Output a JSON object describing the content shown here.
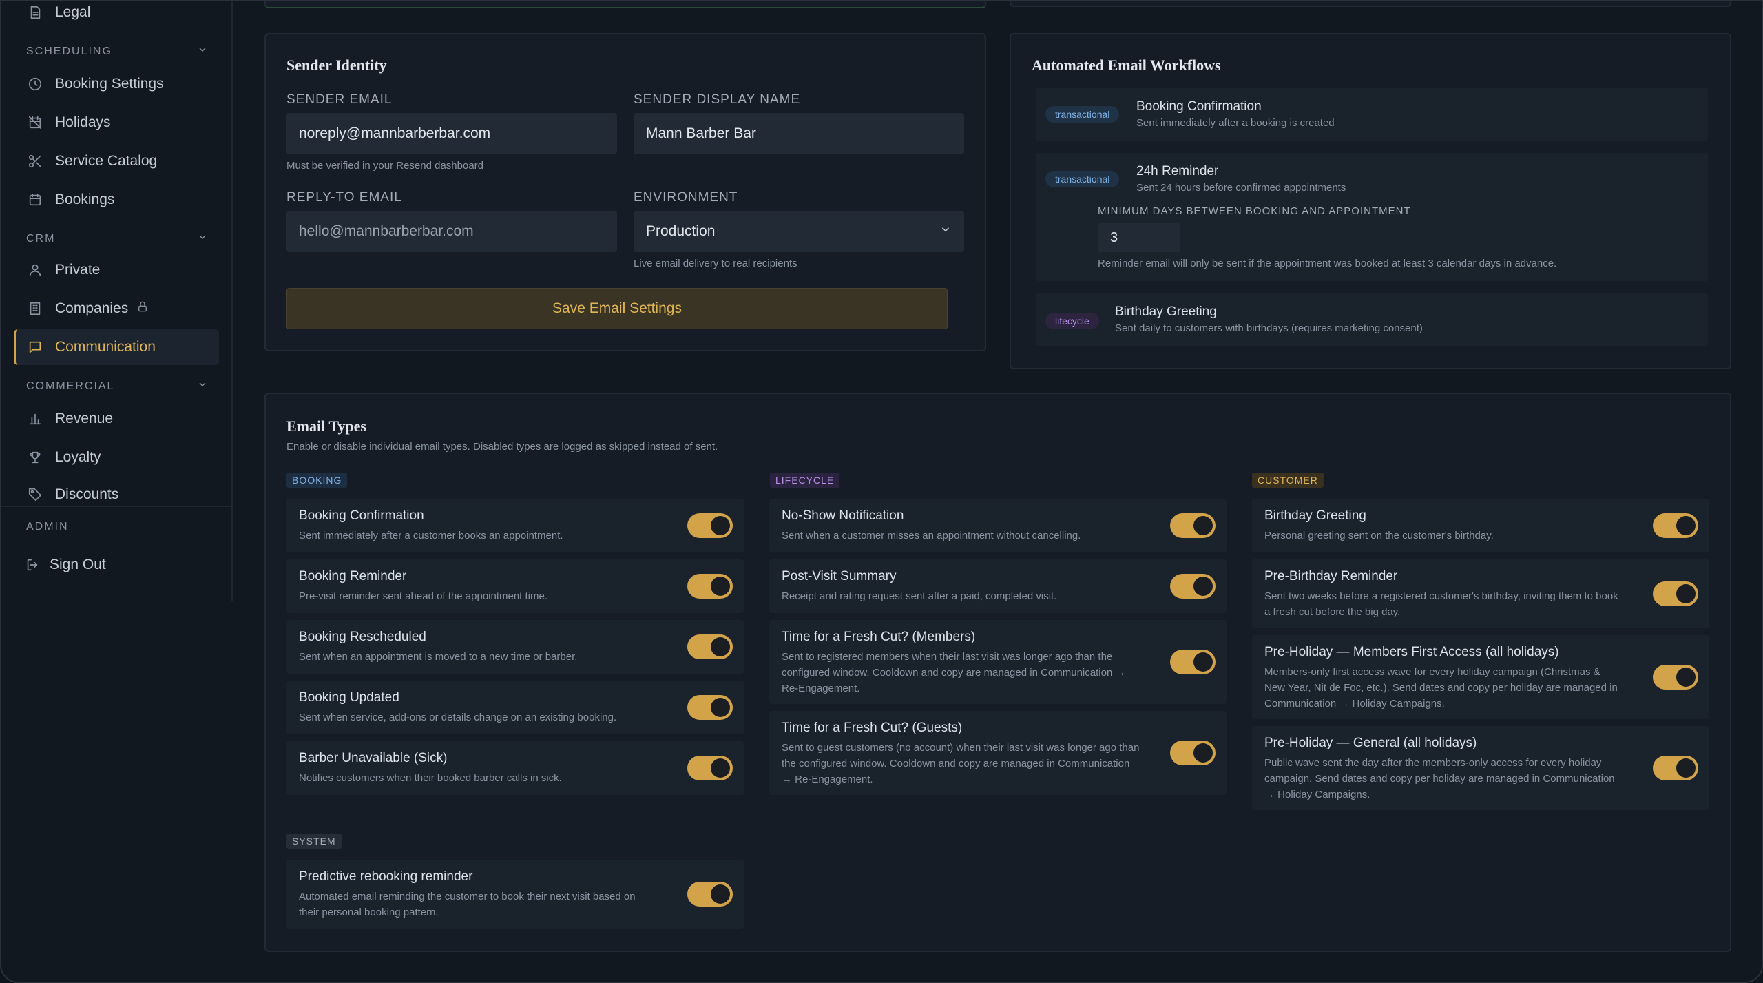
{
  "sidebar": {
    "legal": "Legal",
    "sections": {
      "scheduling": "SCHEDULING",
      "crm": "CRM",
      "commercial": "COMMERCIAL",
      "admin": "ADMIN"
    },
    "items": {
      "booking_settings": "Booking Settings",
      "holidays": "Holidays",
      "service_catalog": "Service Catalog",
      "bookings": "Bookings",
      "private": "Private",
      "companies": "Companies",
      "communication": "Communication",
      "revenue": "Revenue",
      "loyalty": "Loyalty",
      "discounts": "Discounts",
      "sign_out": "Sign Out"
    },
    "accent_color": "#e0b553"
  },
  "sender": {
    "title": "Sender Identity",
    "email_label": "SENDER EMAIL",
    "email_value": "noreply@mannbarberbar.com",
    "email_hint": "Must be verified in your Resend dashboard",
    "display_label": "SENDER DISPLAY NAME",
    "display_value": "Mann Barber Bar",
    "reply_label": "REPLY-TO EMAIL",
    "reply_placeholder": "hello@mannbarberbar.com",
    "env_label": "ENVIRONMENT",
    "env_value": "Production",
    "env_hint": "Live email delivery to real recipients",
    "save_label": "Save Email Settings"
  },
  "workflows": {
    "title": "Automated Email Workflows",
    "items": [
      {
        "badge": "transactional",
        "title": "Booking Confirmation",
        "sub": "Sent immediately after a booking is created"
      },
      {
        "badge": "transactional",
        "title": "24h Reminder",
        "sub": "Sent 24 hours before confirmed appointments",
        "min_label": "MINIMUM DAYS BETWEEN BOOKING AND APPOINTMENT",
        "min_value": "3",
        "min_hint": "Reminder email will only be sent if the appointment was booked at least 3 calendar days in advance."
      },
      {
        "badge": "lifecycle",
        "title": "Birthday Greeting",
        "sub": "Sent daily to customers with birthdays (requires marketing consent)"
      }
    ]
  },
  "email_types": {
    "title": "Email Types",
    "subtitle": "Enable or disable individual email types. Disabled types are logged as skipped instead of sent.",
    "categories": {
      "booking": "BOOKING",
      "lifecycle": "LIFECYCLE",
      "customer": "CUSTOMER",
      "system": "SYSTEM"
    },
    "booking": [
      {
        "title": "Booking Confirmation",
        "desc": "Sent immediately after a customer books an appointment.",
        "enabled": true
      },
      {
        "title": "Booking Reminder",
        "desc": "Pre-visit reminder sent ahead of the appointment time.",
        "enabled": true
      },
      {
        "title": "Booking Rescheduled",
        "desc": "Sent when an appointment is moved to a new time or barber.",
        "enabled": true
      },
      {
        "title": "Booking Updated",
        "desc": "Sent when service, add-ons or details change on an existing booking.",
        "enabled": true
      },
      {
        "title": "Barber Unavailable (Sick)",
        "desc": "Notifies customers when their booked barber calls in sick.",
        "enabled": true
      }
    ],
    "lifecycle": [
      {
        "title": "No-Show Notification",
        "desc": "Sent when a customer misses an appointment without cancelling.",
        "enabled": true
      },
      {
        "title": "Post-Visit Summary",
        "desc": "Receipt and rating request sent after a paid, completed visit.",
        "enabled": true
      },
      {
        "title": "Time for a Fresh Cut? (Members)",
        "desc": "Sent to registered members when their last visit was longer ago than the configured window. Cooldown and copy are managed in Communication → Re-Engagement.",
        "enabled": true
      },
      {
        "title": "Time for a Fresh Cut? (Guests)",
        "desc": "Sent to guest customers (no account) when their last visit was longer ago than the configured window. Cooldown and copy are managed in Communication → Re-Engagement.",
        "enabled": true
      }
    ],
    "customer": [
      {
        "title": "Birthday Greeting",
        "desc": "Personal greeting sent on the customer's birthday.",
        "enabled": true
      },
      {
        "title": "Pre-Birthday Reminder",
        "desc": "Sent two weeks before a registered customer's birthday, inviting them to book a fresh cut before the big day.",
        "enabled": true
      },
      {
        "title": "Pre-Holiday — Members First Access (all holidays)",
        "desc": "Members-only first access wave for every holiday campaign (Christmas & New Year, Nit de Foc, etc.). Send dates and copy per holiday are managed in Communication → Holiday Campaigns.",
        "enabled": true
      },
      {
        "title": "Pre-Holiday — General (all holidays)",
        "desc": "Public wave sent the day after the members-only access for every holiday campaign. Send dates and copy per holiday are managed in Communication → Holiday Campaigns.",
        "enabled": true
      }
    ],
    "system": [
      {
        "title": "Predictive rebooking reminder",
        "desc": "Automated email reminding the customer to book their next visit based on their personal booking pattern.",
        "enabled": true
      }
    ]
  }
}
